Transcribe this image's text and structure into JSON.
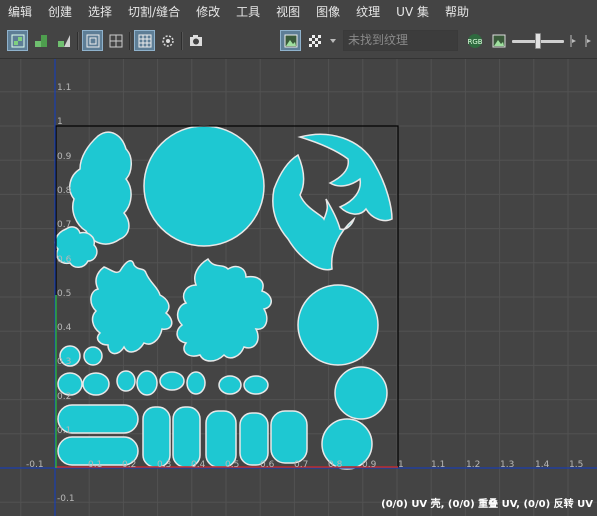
{
  "menu": [
    "编辑",
    "创建",
    "选择",
    "切割/缝合",
    "修改",
    "工具",
    "视图",
    "图像",
    "纹理",
    "UV 集",
    "帮助"
  ],
  "toolbar": {
    "texture_field_placeholder": "未找到纹理",
    "tools": [
      {
        "name": "uv-grid-view-icon",
        "active": true
      },
      {
        "name": "uv-shell-view-icon",
        "active": false
      },
      {
        "name": "uv-flip-view-icon",
        "active": false
      },
      {
        "name": "uv-frame-icon",
        "active": true
      },
      {
        "name": "uv-grid-icon",
        "active": false
      },
      {
        "name": "pixel-grid-icon",
        "active": true
      },
      {
        "name": "isolate-icon",
        "active": false
      },
      {
        "name": "snapshot-icon",
        "active": false
      },
      {
        "name": "image-display-icon",
        "active": true
      },
      {
        "name": "checker-icon",
        "active": false
      },
      {
        "name": "rgb-channels-icon",
        "active": false
      },
      {
        "name": "image-icon",
        "active": false
      }
    ]
  },
  "viewport": {
    "x_ticks": [
      "-0.1",
      "0.1",
      "0.2",
      "0.3",
      "0.4",
      "0.5",
      "0.6",
      "0.7",
      "0.8",
      "0.9",
      "1",
      "1.1",
      "1.2",
      "1.3",
      "1.4",
      "1.5"
    ],
    "y_ticks": [
      "-0.1",
      "0.1",
      "0.2",
      "0.3",
      "0.4",
      "0.5",
      "0.6",
      "0.7",
      "0.8",
      "0.9",
      "1",
      "1.1"
    ],
    "uv_fill_color": "#1ec8d2",
    "uv_border_color": "#e8e8e8"
  },
  "status": "(0/0) UV 壳, (0/0) 重叠 UV, (0/0) 反转 UV"
}
